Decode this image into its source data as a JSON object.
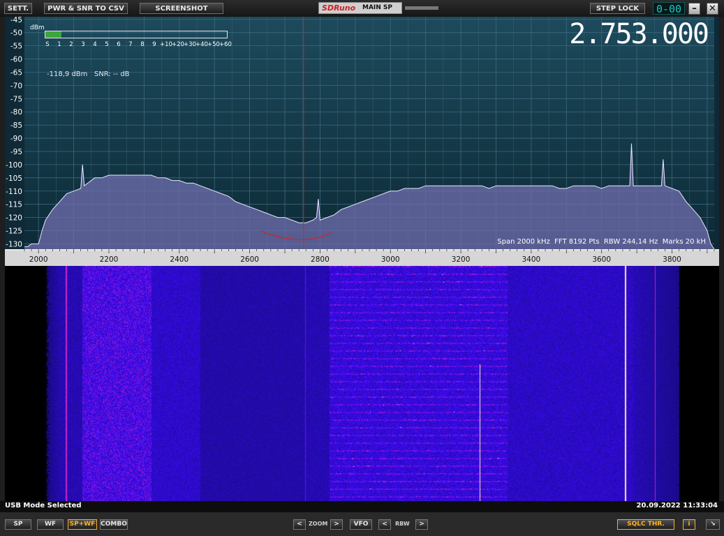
{
  "toolbar": {
    "sett_label": "SETT.",
    "pwr_snr_label": "PWR & SNR TO CSV",
    "screenshot_label": "SCREENSHOT",
    "step_lock_label": "STEP LOCK",
    "step_lcd": "0-00",
    "minimize_label": "–",
    "close_label": "✕"
  },
  "logo": {
    "brand": "SDRuno",
    "panel": "MAIN SP"
  },
  "smeter": {
    "unit": "dBm",
    "scale": [
      "S",
      "1",
      "2",
      "3",
      "4",
      "5",
      "6",
      "7",
      "8",
      "9",
      "+10",
      "+20",
      "+30",
      "+40",
      "+50",
      "+60"
    ],
    "level_fraction": 0.09
  },
  "readout": {
    "power": "-118,9 dBm",
    "snr": "SNR: -- dB"
  },
  "vfo_frequency": "2.753.000",
  "spectrum_info": "Span 2000 kHz  FFT 8192 Pts  RBW 244,14 Hz  Marks 20 kH",
  "chart_data": {
    "type": "area",
    "xlabel": "",
    "ylabel": "dBm",
    "xlim": [
      1960,
      3920
    ],
    "ylim": [
      -132,
      -44
    ],
    "x_ticks": [
      2000,
      2200,
      2400,
      2600,
      2800,
      3000,
      3200,
      3400,
      3600,
      3800
    ],
    "x_tick_labels": [
      "2000",
      "2200",
      "2400",
      "2600",
      "2800",
      "3000",
      "3200",
      "3400",
      "3600",
      "3800"
    ],
    "y_ticks": [
      -45,
      -50,
      -55,
      -60,
      -65,
      -70,
      -75,
      -80,
      -85,
      -90,
      -95,
      -100,
      -105,
      -110,
      -115,
      -120,
      -125,
      -130
    ],
    "y_tick_labels": [
      "-45",
      "-50",
      "-55",
      "-60",
      "-65",
      "-70",
      "-75",
      "-80",
      "-85",
      "-90",
      "-95",
      "-100",
      "-105",
      "-110",
      "-115",
      "-120",
      "-125",
      "-130"
    ],
    "grid": true,
    "marker_khz": 2753,
    "series": [
      {
        "x": [
          1960,
          1970,
          1980,
          1990,
          2000,
          2010,
          2020,
          2040,
          2060,
          2080,
          2100,
          2120,
          2125,
          2130,
          2140,
          2160,
          2180,
          2200,
          2220,
          2240,
          2260,
          2280,
          2300,
          2320,
          2340,
          2360,
          2380,
          2400,
          2420,
          2440,
          2460,
          2480,
          2500,
          2520,
          2540,
          2560,
          2580,
          2600,
          2620,
          2640,
          2660,
          2680,
          2700,
          2720,
          2740,
          2750,
          2760,
          2780,
          2790,
          2795,
          2800,
          2820,
          2840,
          2860,
          2880,
          2900,
          2920,
          2940,
          2960,
          2980,
          3000,
          3020,
          3040,
          3060,
          3080,
          3100,
          3120,
          3140,
          3160,
          3180,
          3200,
          3220,
          3240,
          3260,
          3280,
          3300,
          3320,
          3340,
          3360,
          3380,
          3400,
          3420,
          3440,
          3460,
          3480,
          3500,
          3520,
          3540,
          3560,
          3580,
          3600,
          3620,
          3640,
          3660,
          3680,
          3685,
          3690,
          3700,
          3720,
          3740,
          3760,
          3770,
          3775,
          3780,
          3800,
          3820,
          3840,
          3860,
          3880,
          3900,
          3910,
          3920
        ],
        "values": [
          -131,
          -131,
          -130,
          -130,
          -130,
          -125,
          -121,
          -117,
          -114,
          -111,
          -110,
          -109,
          -100,
          -108,
          -107,
          -105,
          -105,
          -104,
          -104,
          -104,
          -104,
          -104,
          -104,
          -104,
          -105,
          -105,
          -106,
          -106,
          -107,
          -107,
          -108,
          -109,
          -110,
          -111,
          -112,
          -114,
          -115,
          -116,
          -117,
          -118,
          -119,
          -120,
          -120,
          -121,
          -122,
          -122,
          -122,
          -121,
          -120,
          -113,
          -121,
          -120,
          -119,
          -117,
          -116,
          -115,
          -114,
          -113,
          -112,
          -111,
          -110,
          -110,
          -109,
          -109,
          -109,
          -108,
          -108,
          -108,
          -108,
          -108,
          -108,
          -108,
          -108,
          -108,
          -109,
          -108,
          -108,
          -108,
          -108,
          -108,
          -108,
          -108,
          -108,
          -108,
          -109,
          -109,
          -108,
          -108,
          -108,
          -108,
          -109,
          -108,
          -108,
          -108,
          -108,
          -92,
          -108,
          -108,
          -108,
          -108,
          -108,
          -108,
          -98,
          -108,
          -109,
          -110,
          -114,
          -117,
          -120,
          -125,
          -130,
          -132
        ]
      }
    ]
  },
  "status": {
    "mode": "USB Mode Selected",
    "datetime": "20.09.2022 11:33:04"
  },
  "bottom": {
    "sp_label": "SP",
    "wf_label": "WF",
    "spwf_label": "SP+WF",
    "combo_label": "COMBO",
    "zoom_prev": "<",
    "zoom_label": "ZOOM",
    "zoom_next": ">",
    "vfo_label": "VFO",
    "rbw_prev": "<",
    "rbw_label": "RBW",
    "rbw_next": ">",
    "sqlc_label": "SQLC THR.",
    "info_label": "i",
    "expand_label": "↘"
  },
  "colors": {
    "spectrum_bg": "#123848",
    "grid": "#3a6a80",
    "trace_fill": "#6a6aa8",
    "trace_line": "#e8e8ff",
    "marker": "#d82020",
    "waterfall_base": "#1c10b0"
  }
}
